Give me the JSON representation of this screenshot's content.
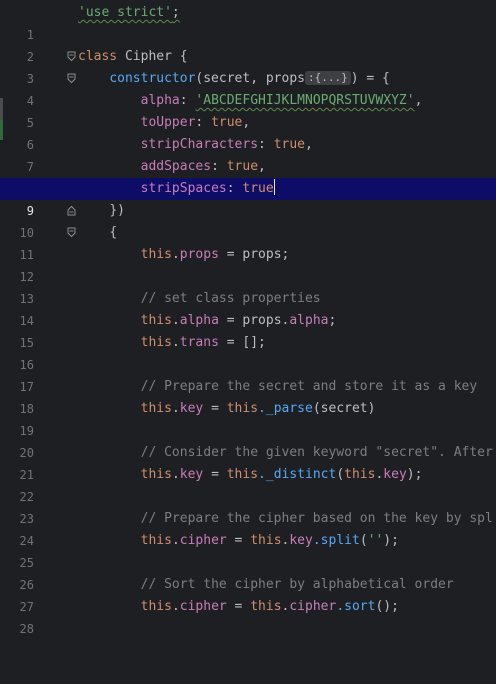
{
  "editor": {
    "current_line": 9,
    "lines": [
      {
        "n": "1"
      },
      {
        "n": "2"
      },
      {
        "n": "3"
      },
      {
        "n": "4"
      },
      {
        "n": "5"
      },
      {
        "n": "6"
      },
      {
        "n": "7"
      },
      {
        "n": "8"
      },
      {
        "n": "9"
      },
      {
        "n": "10"
      },
      {
        "n": "11"
      },
      {
        "n": "12"
      },
      {
        "n": "13"
      },
      {
        "n": "14"
      },
      {
        "n": "15"
      },
      {
        "n": "16"
      },
      {
        "n": "17"
      },
      {
        "n": "18"
      },
      {
        "n": "19"
      },
      {
        "n": "20"
      },
      {
        "n": "21"
      },
      {
        "n": "22"
      },
      {
        "n": "23"
      },
      {
        "n": "24"
      },
      {
        "n": "25"
      },
      {
        "n": "26"
      },
      {
        "n": "27"
      },
      {
        "n": "28"
      }
    ],
    "code": {
      "l1": {
        "str": "'use strict'",
        "semi": ";"
      },
      "l3": {
        "kw": "class",
        "name": " Cipher {"
      },
      "l4": {
        "fn": "constructor",
        "args": "(secret, props",
        "chip": ":{...}",
        "rest": ") = {"
      },
      "l5": {
        "prop": "alpha",
        "colon": ": ",
        "str": "'ABCDEFGHIJKLMNOPQRSTUVWXYZ'",
        "comma": ","
      },
      "l6": {
        "prop": "toUpper",
        "colon": ": ",
        "kw": "true",
        "comma": ","
      },
      "l7": {
        "prop": "stripCharacters",
        "colon": ": ",
        "kw": "true",
        "comma": ","
      },
      "l8": {
        "prop": "addSpaces",
        "colon": ": ",
        "kw": "true",
        "comma": ","
      },
      "l9": {
        "prop": "stripSpaces",
        "colon": ": ",
        "kw": "true"
      },
      "l10": {
        "text": "})"
      },
      "l11": {
        "text": "{"
      },
      "l12": {
        "kw": "this",
        "dot": ".",
        "prop": "props",
        "rest": " = props;"
      },
      "l14": {
        "comment": "// set class properties"
      },
      "l15": {
        "kw": "this",
        "dot": ".",
        "prop": "alpha",
        "mid": " = props.",
        "prop2": "alpha",
        "end": ";"
      },
      "l16": {
        "kw": "this",
        "dot": ".",
        "prop": "trans",
        "rest": " = [];"
      },
      "l18": {
        "comment": "// Prepare the secret and store it as a key"
      },
      "l19": {
        "kw": "this",
        "dot": ".",
        "prop": "key",
        "mid": " = ",
        "kw2": "this",
        "fn": "._parse",
        "rest": "(secret)"
      },
      "l21": {
        "comment": "// Consider the given keyword \"secret\". After"
      },
      "l22": {
        "kw": "this",
        "dot": ".",
        "prop": "key",
        "mid": " = ",
        "kw2": "this",
        "fn": "._distinct",
        "open": "(",
        "kw3": "this",
        "dot2": ".",
        "prop2": "key",
        "end": ");"
      },
      "l24": {
        "comment": "// Prepare the cipher based on the key by spl"
      },
      "l25": {
        "kw": "this",
        "dot": ".",
        "prop": "cipher",
        "mid": " = ",
        "kw2": "this",
        "dot2": ".",
        "prop2": "key",
        "fn": ".split",
        "open": "(",
        "str": "''",
        "end": ");"
      },
      "l27": {
        "comment": "// Sort the cipher by alphabetical order"
      },
      "l28": {
        "kw": "this",
        "dot": ".",
        "prop": "cipher",
        "mid": " = ",
        "kw2": "this",
        "dot2": ".",
        "prop2": "cipher",
        "fn": ".sort",
        "end": "();"
      }
    }
  }
}
